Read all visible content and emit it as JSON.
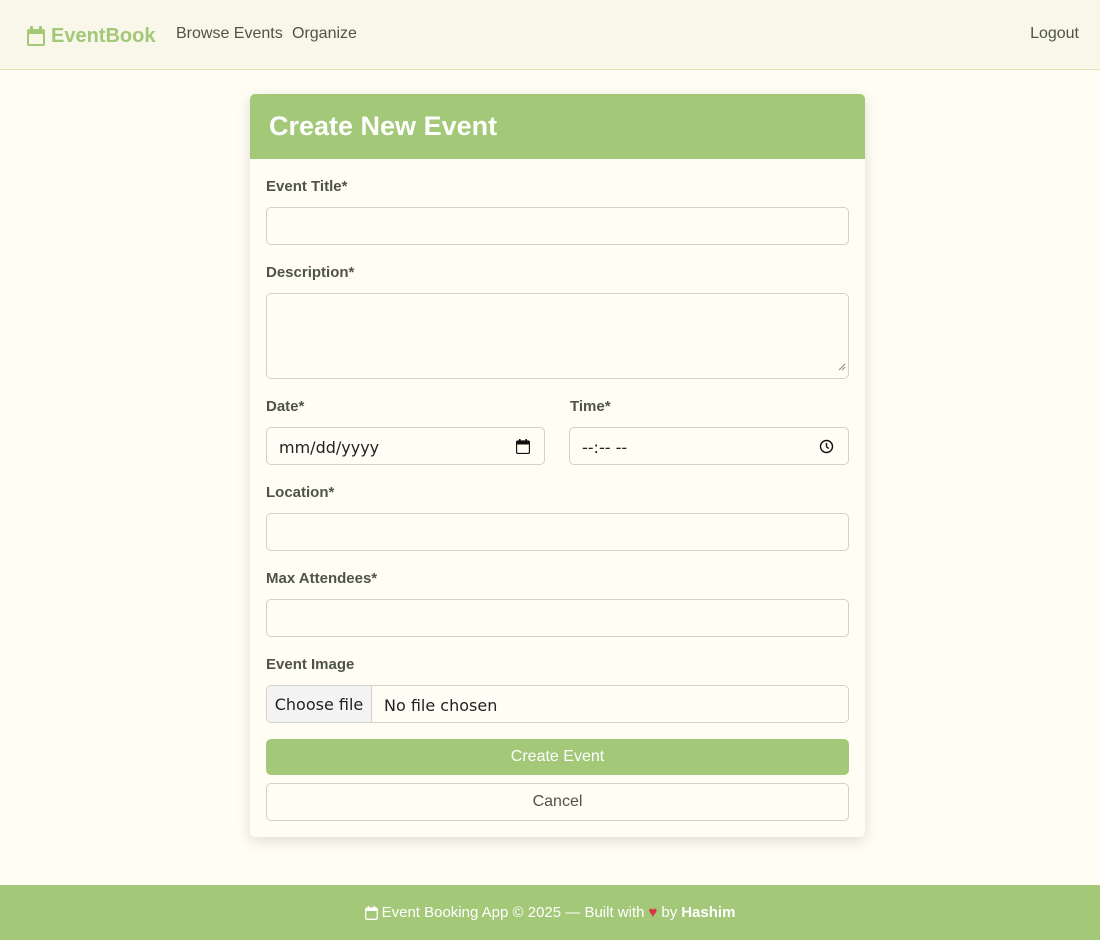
{
  "nav": {
    "brand": "EventBook",
    "brand_icon": "calendar-icon",
    "links": [
      {
        "label": "Browse Events"
      },
      {
        "label": "Organize"
      }
    ],
    "logout": "Logout"
  },
  "form": {
    "title": "Create New Event",
    "fields": {
      "title": {
        "label": "Event Title*",
        "value": ""
      },
      "description": {
        "label": "Description*",
        "value": ""
      },
      "date": {
        "label": "Date*",
        "placeholder": "mm/dd/yyyy",
        "icon": "calendar-icon"
      },
      "time": {
        "label": "Time*",
        "placeholder": "--:-- --",
        "icon": "clock-icon"
      },
      "location": {
        "label": "Location*",
        "value": ""
      },
      "max_attendees": {
        "label": "Max Attendees*",
        "value": ""
      },
      "image": {
        "label": "Event Image",
        "button": "Choose file",
        "status": "No file chosen"
      }
    },
    "submit": "Create Event",
    "cancel": "Cancel"
  },
  "footer": {
    "text_before": "Event Booking App © 2025 — Built with",
    "heart": "♥",
    "by": "by",
    "author": "Hashim"
  },
  "colors": {
    "accent": "#a2c878",
    "page_bg": "#fffdf4",
    "navbar_bg": "#f9f6ea",
    "heart": "#d8344a"
  }
}
